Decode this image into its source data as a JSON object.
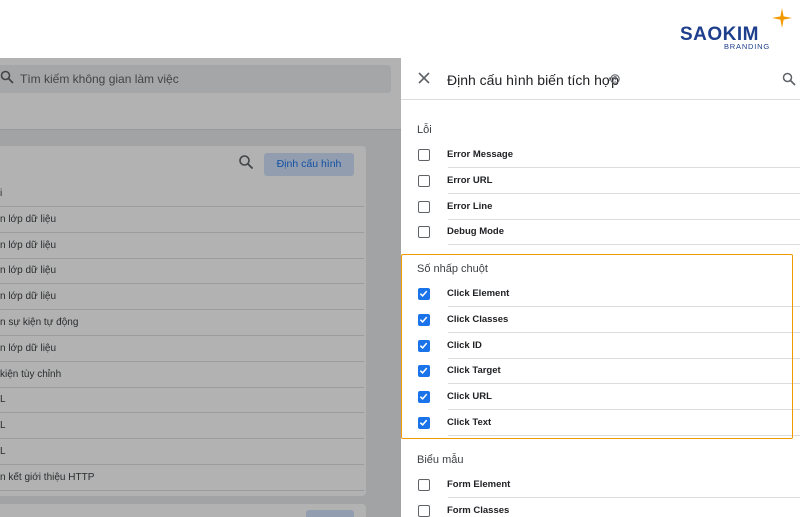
{
  "brand": {
    "name": "SAOKIM",
    "tagline": "BRANDING",
    "colors": {
      "navy": "#1e3f8c",
      "orange": "#f29900"
    }
  },
  "background_app": {
    "search_placeholder": "Tìm kiếm không gian làm việc",
    "config_button": "Định cấu hình",
    "rows": [
      "i",
      "n lớp dữ liệu",
      "n lớp dữ liệu",
      "n lớp dữ liệu",
      "n lớp dữ liệu",
      "n sự kiện tự động",
      "n lớp dữ liệu",
      "kiện tùy chỉnh",
      "L",
      "L",
      "L",
      "n kết giới thiệu HTTP"
    ]
  },
  "panel": {
    "title": "Định cấu hình biến tích hợp",
    "icons": {
      "close": "close-icon",
      "help": "help-icon",
      "search": "search-icon"
    },
    "accent_color": "#1a73e8",
    "sections": [
      {
        "title": "Lỗi",
        "items": [
          {
            "label": "Error Message",
            "checked": false
          },
          {
            "label": "Error URL",
            "checked": false
          },
          {
            "label": "Error Line",
            "checked": false
          },
          {
            "label": "Debug Mode",
            "checked": false
          }
        ]
      },
      {
        "title": "Số nhấp chuột",
        "highlighted": true,
        "items": [
          {
            "label": "Click Element",
            "checked": true
          },
          {
            "label": "Click Classes",
            "checked": true
          },
          {
            "label": "Click ID",
            "checked": true
          },
          {
            "label": "Click Target",
            "checked": true
          },
          {
            "label": "Click URL",
            "checked": true
          },
          {
            "label": "Click Text",
            "checked": true
          }
        ]
      },
      {
        "title": "Biểu mẫu",
        "items": [
          {
            "label": "Form Element",
            "checked": false
          },
          {
            "label": "Form Classes",
            "checked": false
          }
        ]
      }
    ]
  }
}
